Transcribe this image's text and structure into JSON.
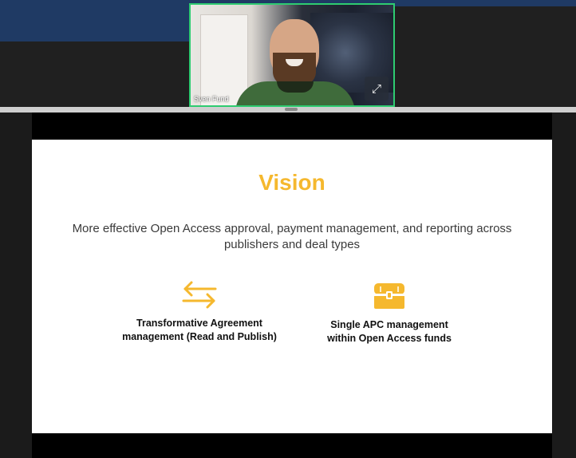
{
  "participant": {
    "name": "Sven Fund",
    "expand_icon": "expand-arrows-icon",
    "expand_glyph": "⤢"
  },
  "slide": {
    "title": "Vision",
    "subtitle": "More effective Open Access approval, payment management, and reporting across publishers and deal types",
    "features": [
      {
        "icon": "swap-arrows-icon",
        "label_line1": "Transformative Agreement",
        "label_line2": "management (Read and Publish)"
      },
      {
        "icon": "treasure-chest-icon",
        "label_line1": "Single APC management",
        "label_line2": "within Open Access funds"
      }
    ]
  },
  "colors": {
    "accent": "#f5b82e",
    "active_speaker_border": "#2ecc71",
    "brand_blue": "#1f3a64"
  }
}
